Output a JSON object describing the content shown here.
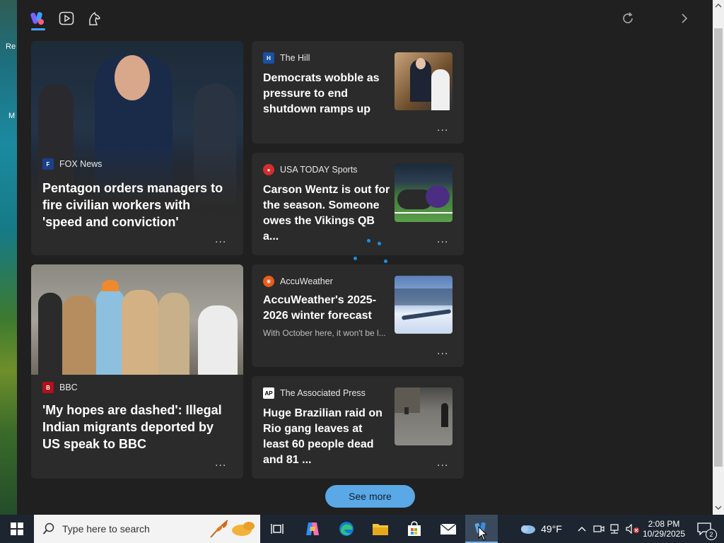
{
  "desktop": {
    "label_top": "Re",
    "label_mid": "M"
  },
  "topbar": {
    "tabs": [
      {
        "name": "feed"
      },
      {
        "name": "video"
      },
      {
        "name": "games"
      }
    ],
    "refresh_icon": "refresh-icon",
    "next_icon": "chevron-right-icon"
  },
  "cards": [
    {
      "id": "c1",
      "source": "FOX News",
      "headline": "Pentagon orders managers to fire civilian workers with 'speed and conviction'",
      "more": "..."
    },
    {
      "id": "c2",
      "source": "The Hill",
      "headline": "Democrats wobble as pressure to end shutdown ramps up",
      "more": "..."
    },
    {
      "id": "c3",
      "source": "USA TODAY Sports",
      "headline": "Carson Wentz is out for the season. Someone owes the Vikings QB a...",
      "more": "..."
    },
    {
      "id": "c4",
      "source": "AccuWeather",
      "headline": "AccuWeather's 2025-2026 winter forecast",
      "snippet": "With October here, it won't be l...",
      "more": "..."
    },
    {
      "id": "c5",
      "source": "BBC",
      "headline": "'My hopes are dashed': Illegal Indian migrants deported by US speak to BBC",
      "more": "..."
    },
    {
      "id": "c6",
      "source": "The Associated Press",
      "headline": "Huge Brazilian raid on Rio gang leaves at least 60 people dead and 81 ...",
      "more": "..."
    }
  ],
  "see_more": "See more",
  "taskbar": {
    "search_placeholder": "Type here to search",
    "weather": "49°F",
    "time": "2:08 PM",
    "date": "10/29/2025",
    "notifications": "2"
  }
}
